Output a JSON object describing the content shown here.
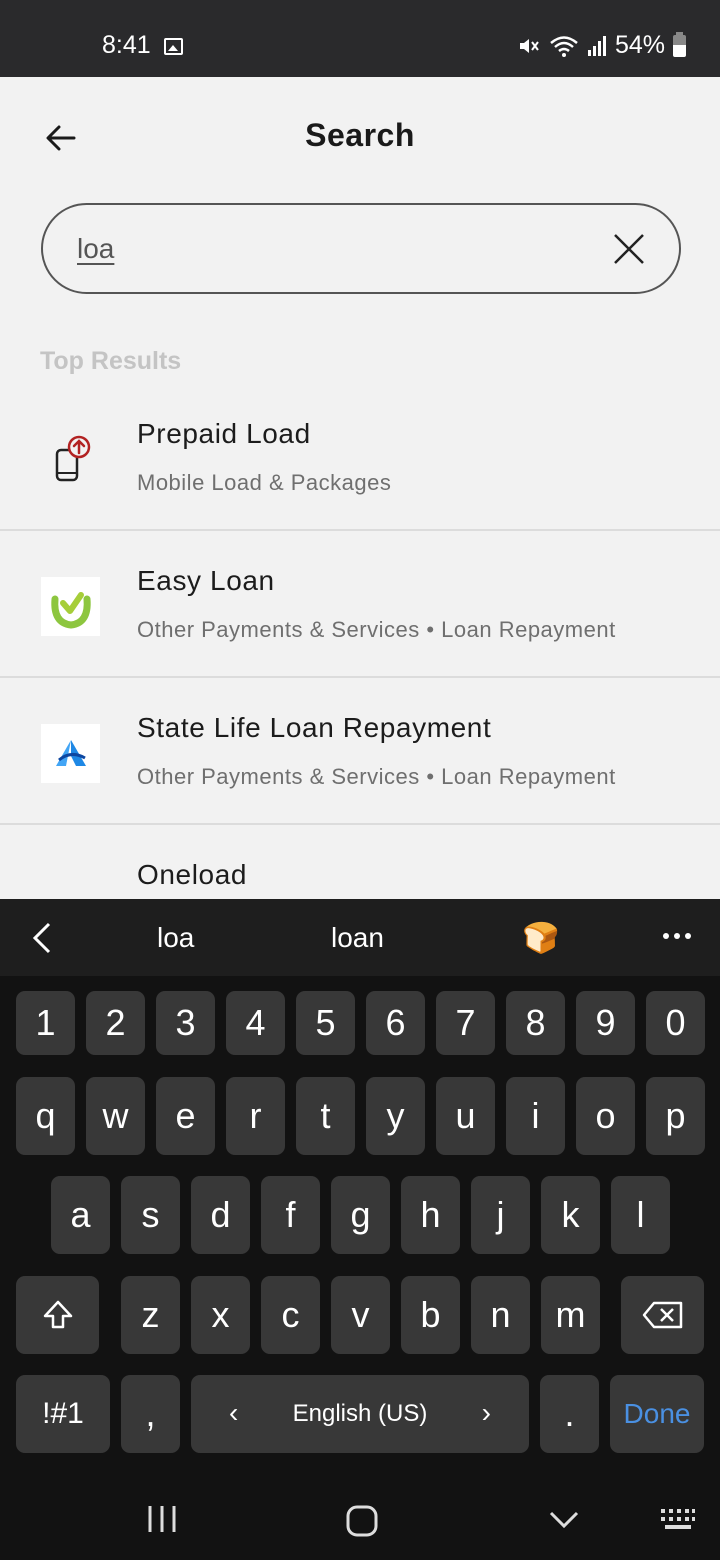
{
  "status_bar": {
    "time": "8:41",
    "battery": "54%"
  },
  "header": {
    "title": "Search"
  },
  "search": {
    "value": "loa"
  },
  "results": {
    "section_title": "Top Results",
    "items": [
      {
        "title": "Prepaid Load",
        "subtitle": "Mobile Load & Packages",
        "icon": "mobile-upload-icon"
      },
      {
        "title": "Easy Loan",
        "subtitle": "Other Payments & Services • Loan Repayment",
        "icon": "easy-loan-logo"
      },
      {
        "title": "State Life Loan Repayment",
        "subtitle": "Other Payments & Services • Loan Repayment",
        "icon": "state-life-logo"
      },
      {
        "title": "Oneload",
        "subtitle": "",
        "icon": "oneload-logo"
      }
    ]
  },
  "keyboard": {
    "suggestions": [
      "loa",
      "loan"
    ],
    "suggestion_emoji": "🍞",
    "row_numbers": [
      "1",
      "2",
      "3",
      "4",
      "5",
      "6",
      "7",
      "8",
      "9",
      "0"
    ],
    "row_1": [
      "q",
      "w",
      "e",
      "r",
      "t",
      "y",
      "u",
      "i",
      "o",
      "p"
    ],
    "row_2": [
      "a",
      "s",
      "d",
      "f",
      "g",
      "h",
      "j",
      "k",
      "l"
    ],
    "row_3": [
      "z",
      "x",
      "c",
      "v",
      "b",
      "n",
      "m"
    ],
    "symbols_label": "!#1",
    "comma_label": ",",
    "space_label": "English (US)",
    "period_label": ".",
    "done_label": "Done",
    "accent_color": "#4a90e2"
  }
}
